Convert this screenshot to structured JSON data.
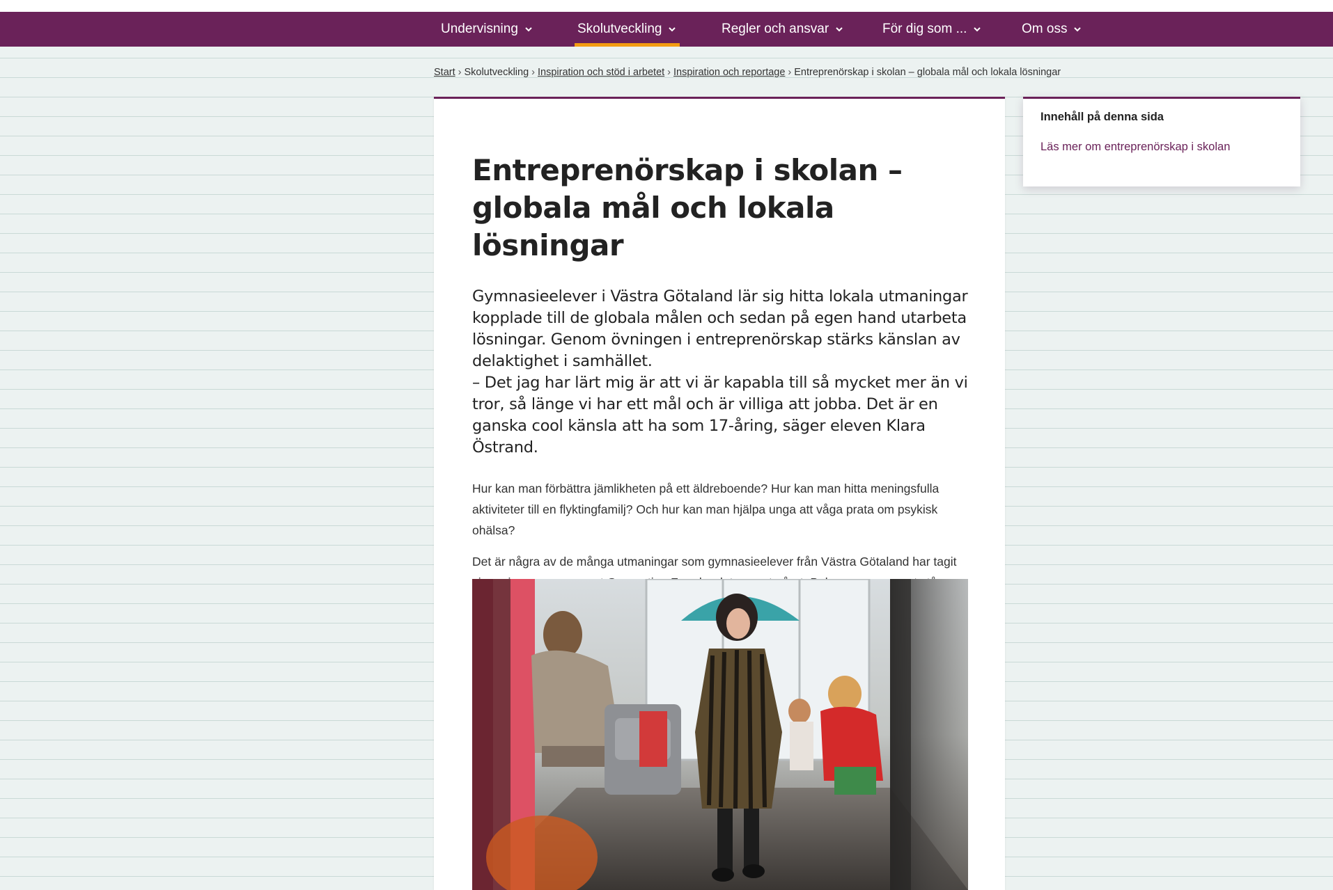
{
  "nav": {
    "items": [
      {
        "label": "Undervisning"
      },
      {
        "label": "Skolutveckling"
      },
      {
        "label": "Regler och ansvar"
      },
      {
        "label": "För dig som ..."
      },
      {
        "label": "Om oss"
      }
    ],
    "active": "Skolutveckling"
  },
  "breadcrumb": {
    "items": [
      {
        "label": "Start",
        "link": true
      },
      {
        "label": "Skolutveckling",
        "link": false
      },
      {
        "label": "Inspiration och stöd i arbetet",
        "link": true
      },
      {
        "label": "Inspiration och reportage",
        "link": true
      },
      {
        "label": "Entreprenörskap i skolan – globala mål och lokala lösningar",
        "link": false
      }
    ],
    "separator": "›"
  },
  "article": {
    "title": "Entreprenörskap i skolan – globala mål och lokala lösningar",
    "lead_1": "Gymnasieelever i Västra Götaland lär sig hitta lokala utmaningar kopplade till de globala målen och sedan på egen hand utarbeta lösningar. Genom övningen i entreprenörskap stärks känslan av delaktighet i samhället.",
    "lead_2": "– Det jag har lärt mig är att vi är kapabla till så mycket mer än vi tror, så länge vi har ett mål och är villiga att jobba. Det är en ganska cool känsla att ha som 17-åring, säger eleven Klara Östrand.",
    "paragraph_1": "Hur kan man förbättra jämlikheten på ett äldreboende? Hur kan man hitta meningsfulla aktiviteter till en flyktingfamilj? Och hur kan man hjälpa unga att våga prata om psykisk ohälsa?",
    "paragraph_2": "Det är några av de många utmaningar som gymnasieelever från Västra Götaland har tagit sig an inom programmet Generation F under det senaste året. Bakom programmet står Förebildarna i Göteborg. Syftet är att med entreprenöriella metoder stärka ungas delaktighet i samhället."
  },
  "toc": {
    "title": "Innehåll på denna sida",
    "link": "Läs mer om entreprenörskap i skolan"
  },
  "colors": {
    "brand": "#6a2259",
    "accent": "#f39c12",
    "background": "#ecf2f1"
  }
}
